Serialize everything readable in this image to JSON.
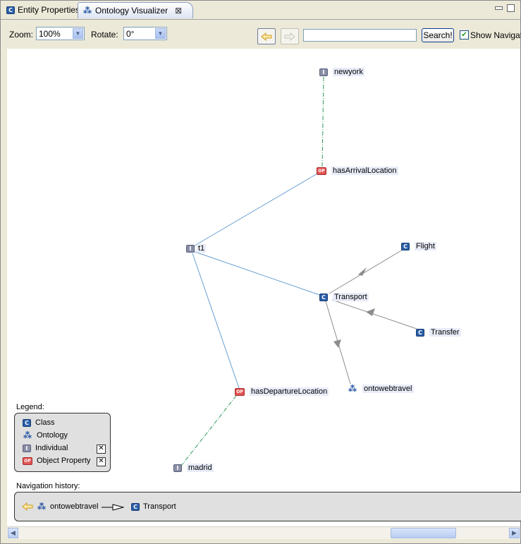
{
  "tabs": [
    {
      "label": "Entity Properties",
      "icon": "class-icon"
    },
    {
      "label": "Ontology Visualizer",
      "icon": "ontology-icon",
      "close": "⊠"
    }
  ],
  "toolbar": {
    "zoom_label": "Zoom:",
    "zoom_value": "100%",
    "rotate_label": "Rotate:",
    "rotate_value": "0°",
    "back_icon": "back-arrow-icon",
    "forward_icon": "forward-arrow-icon",
    "search_value": "",
    "search_button": "Search!",
    "show_navigation_label": "Show Navigatio",
    "show_navigation_checked": true
  },
  "graph": {
    "nodes": [
      {
        "id": "newyork",
        "type": "individual",
        "badge": "I",
        "label": "newyork"
      },
      {
        "id": "hasArrivalLocation",
        "type": "object-property",
        "badge": "OP",
        "label": "hasArrivalLocation"
      },
      {
        "id": "t1",
        "type": "individual",
        "badge": "I",
        "label": "t1"
      },
      {
        "id": "Flight",
        "type": "class",
        "badge": "C",
        "label": "Flight"
      },
      {
        "id": "Transport",
        "type": "class",
        "badge": "C",
        "label": "Transport"
      },
      {
        "id": "Transfer",
        "type": "class",
        "badge": "C",
        "label": "Transfer"
      },
      {
        "id": "ontowebtravel",
        "type": "ontology",
        "badge": "⁂",
        "label": "ontowebtravel"
      },
      {
        "id": "hasDepartureLocation",
        "type": "object-property",
        "badge": "OP",
        "label": "hasDepartureLocation"
      },
      {
        "id": "madrid",
        "type": "individual",
        "badge": "I",
        "label": "madrid"
      }
    ]
  },
  "legend": {
    "title": "Legend:",
    "items": [
      {
        "label": "Class",
        "badge": "C",
        "type": "class",
        "toggle": false
      },
      {
        "label": "Ontology",
        "badge": "⁂",
        "type": "ontology",
        "toggle": false
      },
      {
        "label": "Individual",
        "badge": "I",
        "type": "individual",
        "toggle": true,
        "toggle_mark": "✕"
      },
      {
        "label": "Object Property",
        "badge": "OP",
        "type": "object-property",
        "toggle": true,
        "toggle_mark": "✕"
      }
    ]
  },
  "history": {
    "title": "Navigation history:",
    "back_icon": "back-arrow-icon",
    "items": [
      {
        "label": "ontowebtravel",
        "badge": "⁂",
        "type": "ontology"
      },
      {
        "label": "Transport",
        "badge": "C",
        "type": "class"
      }
    ]
  },
  "colors": {
    "assertion_edge": "#6a9fd4",
    "subclass_edge": "#8c8c8c",
    "property_value_edge": "#2e9a5a",
    "class_icon": "#2a5fa8",
    "individual_icon": "#8a8fa8",
    "property_icon": "#e05555"
  }
}
